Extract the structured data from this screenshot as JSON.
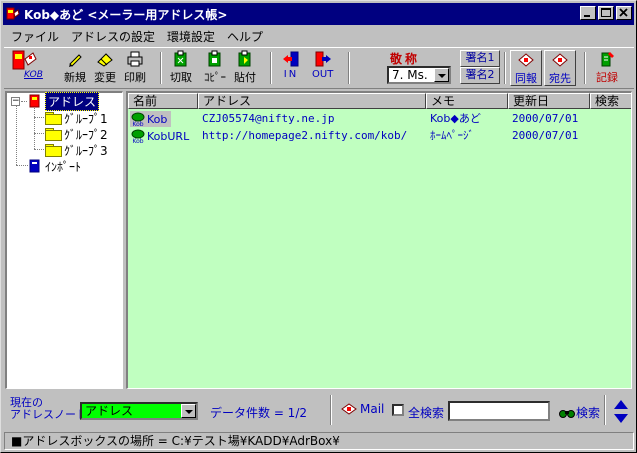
{
  "window": {
    "title": "Kob◆あど <メーラー用アドレス帳>",
    "min_label": "_",
    "max_label": "□",
    "close_label": "×"
  },
  "menu": [
    {
      "label": "ファイル"
    },
    {
      "label": "アドレスの設定"
    },
    {
      "label": "環境設定"
    },
    {
      "label": "ヘルプ"
    }
  ],
  "toolbar": {
    "new_label": "新規",
    "edit_label": "変更",
    "print_label": "印刷",
    "cut_label": "切取",
    "copy_label": "ｺﾋﾟｰ",
    "paste_label": "貼付",
    "in_label": "IN",
    "out_label": "OUT",
    "keisho_label": "敬称",
    "keisho_value": "7. Ms.",
    "sign1_label": "署名1",
    "sign2_label": "署名2",
    "cc_label": "同報",
    "to_label": "宛先",
    "record_label": "記録",
    "logo_label": "KOB"
  },
  "tree": {
    "root": "アドレス",
    "groups": [
      "ｸﾞﾙｰﾌﾟ1",
      "ｸﾞﾙｰﾌﾟ2",
      "ｸﾞﾙｰﾌﾟ3"
    ],
    "import": "ｲﾝﾎﾟｰﾄ"
  },
  "grid": {
    "headers": [
      "名前",
      "アドレス",
      "メモ",
      "更新日",
      "検索"
    ],
    "rows": [
      {
        "name": "Kob",
        "address": "CZJ05574@nifty.ne.jp",
        "memo": "Kob◆あど",
        "date": "2000/07/01"
      },
      {
        "name": "KobURL",
        "address": "http://homepage2.nifty.com/kob/",
        "memo": "ﾎｰﾑﾍﾟｰｼﾞ",
        "date": "2000/07/01"
      }
    ]
  },
  "status": {
    "current_label_1": "現在の",
    "current_label_2": "アドレスノート",
    "current_value": "アドレス",
    "count_text": "データ件数 = 1/2",
    "mail_label": "Mail",
    "all_search_label": "全検索",
    "search_value": "",
    "search_button": "検索",
    "path_text": "■アドレスボックスの場所 = C:¥テスト場¥KADD¥AdrBox¥"
  },
  "colors": {
    "titlebar": "#000080",
    "grid_bg": "#c0ffc0",
    "combo_green": "#00ff00",
    "text_blue": "#0000c0"
  }
}
